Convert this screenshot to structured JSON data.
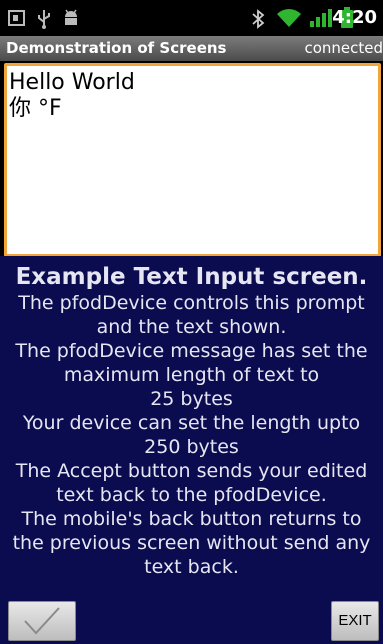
{
  "status_bar": {
    "time": "4:20",
    "icons": [
      "screen-icon",
      "usb-icon",
      "android-debug-icon",
      "bluetooth-icon",
      "wifi-icon",
      "signal-icon",
      "battery-icon"
    ]
  },
  "title_bar": {
    "title": "Demonstration of Screens",
    "status": "connected"
  },
  "text_input": {
    "lines": [
      "Hello World",
      "你 °F"
    ]
  },
  "prompt": {
    "heading": "Example Text Input screen.",
    "lines": [
      "The pfodDevice controls this prompt",
      "and the text shown.",
      "The pfodDevice message has set the",
      "maximum length of text to",
      "25 bytes",
      "Your device can set the length upto",
      "250 bytes",
      "The Accept button sends your edited",
      "text back to the pfodDevice.",
      "The mobile's back button returns to",
      "the previous screen without send any",
      "text back."
    ]
  },
  "buttons": {
    "accept_icon": "checkmark-icon",
    "exit_label": "EXIT"
  },
  "colors": {
    "prompt_background": "#0b0b4f",
    "input_border": "#f0a43a"
  }
}
